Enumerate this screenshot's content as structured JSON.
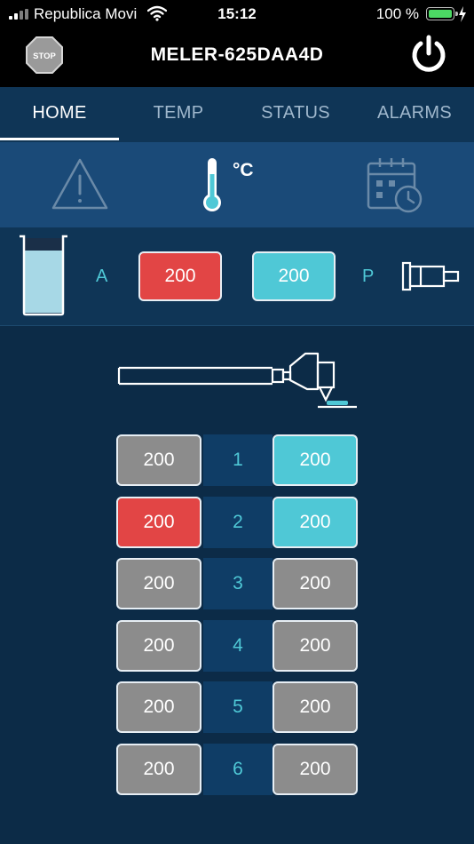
{
  "status_bar": {
    "carrier": "Republica Movi",
    "time": "15:12",
    "battery": "100 %"
  },
  "header": {
    "title": "MELER-625DAA4D",
    "stop_label": "STOP"
  },
  "tabs": [
    {
      "label": "HOME",
      "active": true
    },
    {
      "label": "TEMP",
      "active": false
    },
    {
      "label": "STATUS",
      "active": false
    },
    {
      "label": "ALARMS",
      "active": false
    }
  ],
  "subtabs": {
    "unit": "°C",
    "icons": [
      "warning-icon",
      "thermometer-icon",
      "calendar-clock-icon"
    ]
  },
  "tank": {
    "label_a": "A",
    "label_p": "P",
    "tank_value": "200",
    "tank_color": "#e24545",
    "pump_value": "200",
    "pump_color": "#4fc8d6"
  },
  "rows": [
    {
      "num": "1",
      "hose": "200",
      "hose_color": "#8c8c8c",
      "gun": "200",
      "gun_color": "#4fc8d6"
    },
    {
      "num": "2",
      "hose": "200",
      "hose_color": "#e24545",
      "gun": "200",
      "gun_color": "#4fc8d6"
    },
    {
      "num": "3",
      "hose": "200",
      "hose_color": "#8c8c8c",
      "gun": "200",
      "gun_color": "#8c8c8c"
    },
    {
      "num": "4",
      "hose": "200",
      "hose_color": "#8c8c8c",
      "gun": "200",
      "gun_color": "#8c8c8c"
    },
    {
      "num": "5",
      "hose": "200",
      "hose_color": "#8c8c8c",
      "gun": "200",
      "gun_color": "#8c8c8c"
    },
    {
      "num": "6",
      "hose": "200",
      "hose_color": "#8c8c8c",
      "gun": "200",
      "gun_color": "#8c8c8c"
    }
  ]
}
